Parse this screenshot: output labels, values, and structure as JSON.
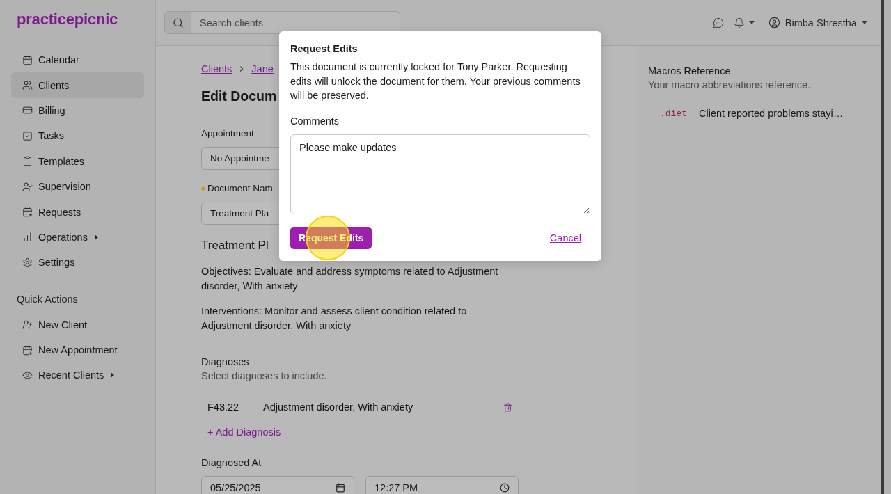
{
  "sidebar": {
    "logo": "practicepicnic",
    "nav": [
      {
        "label": "Calendar",
        "selected": false,
        "expandable": false
      },
      {
        "label": "Clients",
        "selected": true,
        "expandable": false
      },
      {
        "label": "Billing",
        "selected": false,
        "expandable": false
      },
      {
        "label": "Tasks",
        "selected": false,
        "expandable": false
      },
      {
        "label": "Templates",
        "selected": false,
        "expandable": false
      },
      {
        "label": "Supervision",
        "selected": false,
        "expandable": false
      },
      {
        "label": "Requests",
        "selected": false,
        "expandable": false
      },
      {
        "label": "Operations",
        "selected": false,
        "expandable": true
      },
      {
        "label": "Settings",
        "selected": false,
        "expandable": false
      }
    ],
    "quick_actions": {
      "title": "Quick Actions",
      "items": [
        {
          "label": "New Client",
          "expandable": false
        },
        {
          "label": "New Appointment",
          "expandable": false
        },
        {
          "label": "Recent Clients",
          "expandable": true
        }
      ]
    }
  },
  "topbar": {
    "search": {
      "placeholder": "Search clients"
    },
    "user": {
      "name": "Bimba Shrestha"
    }
  },
  "page": {
    "breadcrumb": [
      {
        "label": "Clients"
      },
      {
        "label": "Jane"
      }
    ],
    "title": "Edit Docum",
    "appointment": {
      "label": "Appointment",
      "value": "No Appointme"
    },
    "document_name": {
      "label": "Document Nam",
      "required": true,
      "value": "Treatment Pla"
    },
    "section_title": "Treatment Pl",
    "paragraphs": [
      "Objectives: Evaluate and address symptoms related to Adjustment disorder, With anxiety",
      "Interventions: Monitor and assess client condition related to Adjustment disorder, With anxiety"
    ],
    "diagnoses": {
      "label": "Diagnoses",
      "hint": "Select diagnoses to include.",
      "rows": [
        {
          "code": "F43.22",
          "name": "Adjustment disorder, With anxiety"
        }
      ],
      "add_label": "+ Add Diagnosis"
    },
    "diagnosed_at": {
      "label": "Diagnosed At",
      "date": "05/25/2025",
      "time": "12:27 PM"
    }
  },
  "macros_panel": {
    "title": "Macros Reference",
    "subtitle": "Your macro abbreviations reference.",
    "macros": [
      {
        "abbreviation": ".diet",
        "text": "Client reported problems stayi…"
      }
    ]
  },
  "modal": {
    "title": "Request Edits",
    "message": "This document is currently locked for Tony Parker. Requesting edits will unlock the document for them. Your previous comments will be preserved.",
    "comments": {
      "label": "Comments",
      "value": "Please make updates"
    },
    "buttons": [
      {
        "label": "Request Edits",
        "kind": "primary"
      },
      {
        "label": "Cancel",
        "kind": "link"
      }
    ]
  }
}
